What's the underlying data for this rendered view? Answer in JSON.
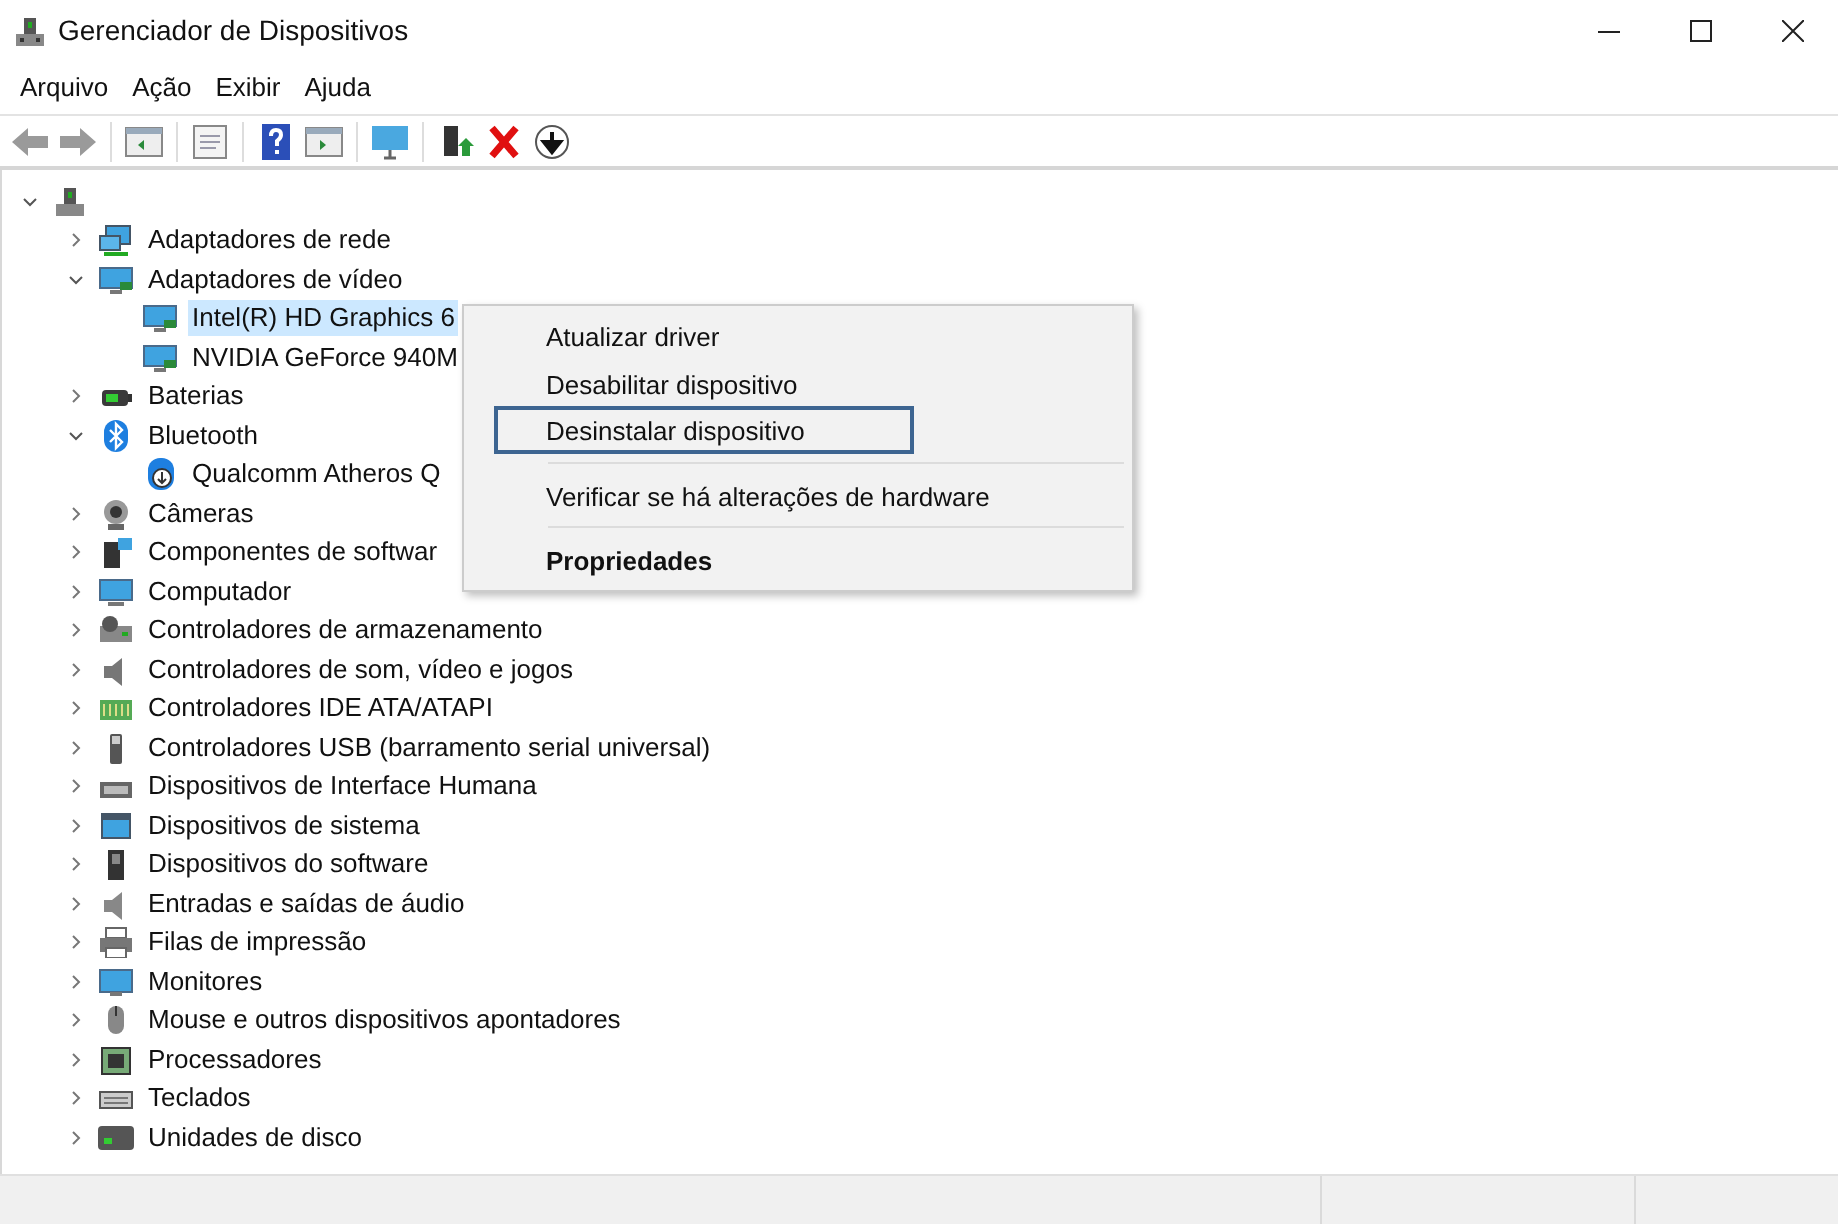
{
  "window": {
    "title": "Gerenciador de Dispositivos"
  },
  "menu_bar": [
    "Arquivo",
    "Ação",
    "Exibir",
    "Ajuda"
  ],
  "tree": {
    "expanded": true,
    "children": [
      {
        "label": "Adaptadores de rede",
        "expanded": false
      },
      {
        "label": "Adaptadores de vídeo",
        "expanded": true,
        "children": [
          {
            "label": "Intel(R) HD Graphics 6",
            "selected": true
          },
          {
            "label": "NVIDIA GeForce 940M",
            "selected": false
          }
        ]
      },
      {
        "label": "Baterias",
        "expanded": false
      },
      {
        "label": "Bluetooth",
        "expanded": true,
        "children": [
          {
            "label": "Qualcomm Atheros Q",
            "selected": false
          }
        ]
      },
      {
        "label": "Câmeras",
        "expanded": false
      },
      {
        "label": "Componentes de softwar",
        "expanded": false
      },
      {
        "label": "Computador",
        "expanded": false
      },
      {
        "label": "Controladores de armazenamento",
        "expanded": false
      },
      {
        "label": "Controladores de som, vídeo e jogos",
        "expanded": false
      },
      {
        "label": "Controladores IDE ATA/ATAPI",
        "expanded": false
      },
      {
        "label": "Controladores USB (barramento serial universal)",
        "expanded": false
      },
      {
        "label": "Dispositivos de Interface Humana",
        "expanded": false
      },
      {
        "label": "Dispositivos de sistema",
        "expanded": false
      },
      {
        "label": "Dispositivos do software",
        "expanded": false
      },
      {
        "label": "Entradas e saídas de áudio",
        "expanded": false
      },
      {
        "label": "Filas de impressão",
        "expanded": false
      },
      {
        "label": "Monitores",
        "expanded": false
      },
      {
        "label": "Mouse e outros dispositivos apontadores",
        "expanded": false
      },
      {
        "label": "Processadores",
        "expanded": false
      },
      {
        "label": "Teclados",
        "expanded": false
      },
      {
        "label": "Unidades de disco",
        "expanded": false
      }
    ]
  },
  "context_menu": [
    {
      "kind": "item",
      "label": "Atualizar driver",
      "focused": false,
      "default": false
    },
    {
      "kind": "item",
      "label": "Desabilitar dispositivo",
      "focused": false,
      "default": false
    },
    {
      "kind": "item",
      "label": "Desinstalar dispositivo",
      "focused": true,
      "default": false
    },
    {
      "kind": "separator"
    },
    {
      "kind": "item",
      "label": "Verificar se há alterações de hardware",
      "focused": false,
      "default": false
    },
    {
      "kind": "separator"
    },
    {
      "kind": "item",
      "label": "Propriedades",
      "focused": false,
      "default": true
    }
  ]
}
